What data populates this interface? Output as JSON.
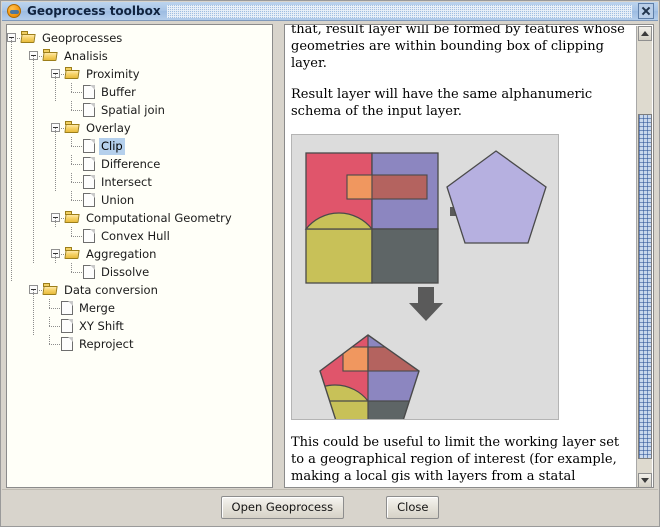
{
  "window": {
    "title": "Geoprocess toolbox",
    "app_icon": "globe-icon",
    "close_icon": "close-icon"
  },
  "tree": {
    "selected": "Clip",
    "nodes": [
      {
        "label": "Geoprocesses",
        "depth": 0,
        "type": "folder",
        "expanded": true
      },
      {
        "label": "Analisis",
        "depth": 1,
        "type": "folder",
        "expanded": true
      },
      {
        "label": "Proximity",
        "depth": 2,
        "type": "folder",
        "expanded": true
      },
      {
        "label": "Buffer",
        "depth": 3,
        "type": "file"
      },
      {
        "label": "Spatial join",
        "depth": 3,
        "type": "file"
      },
      {
        "label": "Overlay",
        "depth": 2,
        "type": "folder",
        "expanded": true
      },
      {
        "label": "Clip",
        "depth": 3,
        "type": "file",
        "selected": true
      },
      {
        "label": "Difference",
        "depth": 3,
        "type": "file"
      },
      {
        "label": "Intersect",
        "depth": 3,
        "type": "file"
      },
      {
        "label": "Union",
        "depth": 3,
        "type": "file"
      },
      {
        "label": "Computational Geometry",
        "depth": 2,
        "type": "folder",
        "expanded": true
      },
      {
        "label": "Convex Hull",
        "depth": 3,
        "type": "file"
      },
      {
        "label": "Aggregation",
        "depth": 2,
        "type": "folder",
        "expanded": true
      },
      {
        "label": "Dissolve",
        "depth": 3,
        "type": "file"
      },
      {
        "label": "Data conversion",
        "depth": 1,
        "type": "folder",
        "expanded": true
      },
      {
        "label": "Merge",
        "depth": 2,
        "type": "file"
      },
      {
        "label": "XY Shift",
        "depth": 2,
        "type": "file"
      },
      {
        "label": "Reproject",
        "depth": 2,
        "type": "file"
      }
    ]
  },
  "doc": {
    "paragraph1": "that, result layer will be formed by features whose geometries are within bounding box of clipping layer.",
    "paragraph2": "Result layer will have the same alphanumeric schema of the input layer.",
    "paragraph3": "This could be useful to limit the working layer set to a geographical region of interest (for example, making a local gis with layers from a statal dataset).",
    "figure": {
      "name": "clip-operation-diagram",
      "plus_symbol": "+",
      "arrow_symbol": "down-arrow",
      "colors": {
        "pink": "#e0556b",
        "purple": "#8c86c0",
        "olive": "#c8c158",
        "slate": "#5e6566",
        "orange": "#f0975f",
        "brick": "#b4635f",
        "lavender": "#b6b0e0",
        "background": "#dcdcdc",
        "outline": "#4a4a4a",
        "arrow": "#5a5a5a"
      }
    }
  },
  "scrollbar": {
    "up_icon": "scroll-up-arrow-icon",
    "down_icon": "scroll-down-arrow-icon"
  },
  "buttons": {
    "open": "Open Geoprocess",
    "close": "Close"
  }
}
